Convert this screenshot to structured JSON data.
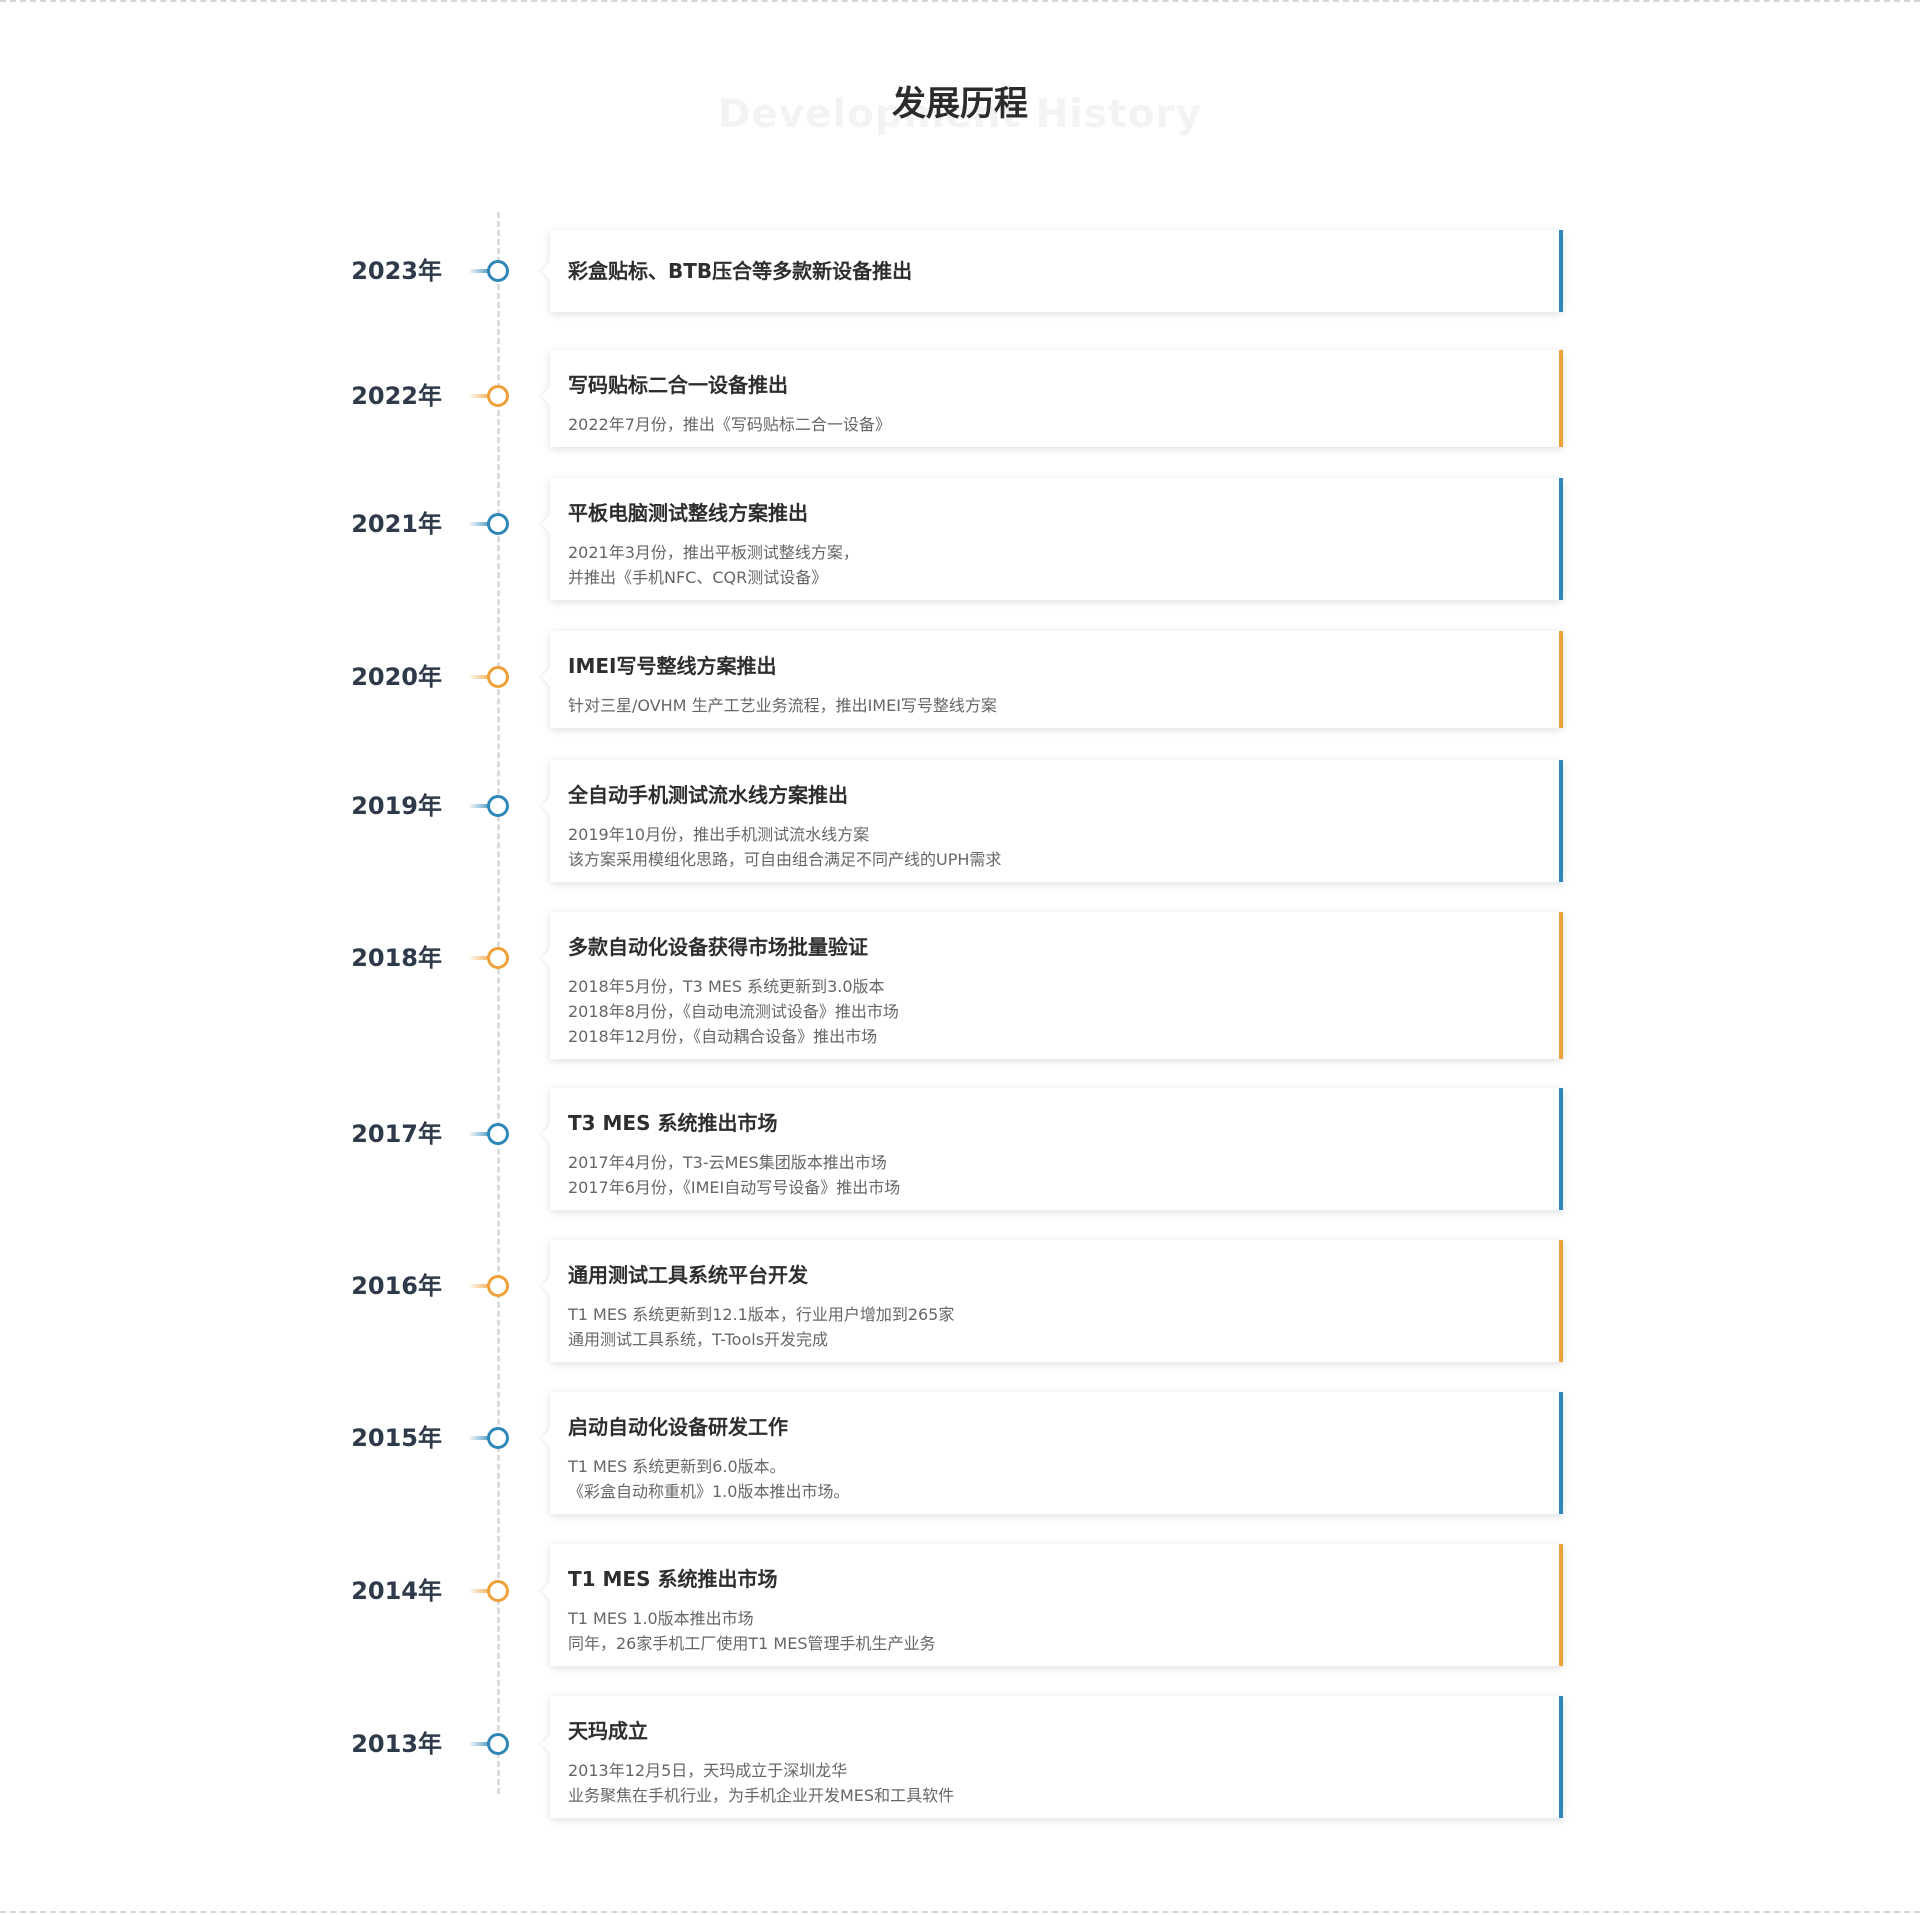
{
  "heading": {
    "title": "发展历程",
    "subtitle": "Development History"
  },
  "colors": {
    "blue": "#2f86b8",
    "orange": "#eea03a"
  },
  "timeline": [
    {
      "year": "2023年",
      "color": "blue",
      "title": "彩盒贴标、BTB压合等多款新设备推出",
      "lines": []
    },
    {
      "year": "2022年",
      "color": "orange",
      "title": "写码贴标二合一设备推出",
      "lines": [
        "2022年7月份，推出《写码贴标二合一设备》"
      ]
    },
    {
      "year": "2021年",
      "color": "blue",
      "title": "平板电脑测试整线方案推出",
      "lines": [
        "2021年3月份，推出平板测试整线方案，",
        "并推出《手机NFC、CQR测试设备》"
      ]
    },
    {
      "year": "2020年",
      "color": "orange",
      "title": "IMEI写号整线方案推出",
      "lines": [
        "针对三星/OVHM 生产工艺业务流程，推出IMEI写号整线方案"
      ]
    },
    {
      "year": "2019年",
      "color": "blue",
      "title": "全自动手机测试流水线方案推出",
      "lines": [
        "2019年10月份，推出手机测试流水线方案",
        "该方案采用模组化思路，可自由组合满足不同产线的UPH需求"
      ]
    },
    {
      "year": "2018年",
      "color": "orange",
      "title": "多款自动化设备获得市场批量验证",
      "lines": [
        "2018年5月份，T3 MES 系统更新到3.0版本",
        "2018年8月份，《自动电流测试设备》推出市场",
        "2018年12月份，《自动耦合设备》推出市场"
      ]
    },
    {
      "year": "2017年",
      "color": "blue",
      "title": "T3 MES 系统推出市场",
      "lines": [
        "2017年4月份，T3-云MES集团版本推出市场",
        "2017年6月份，《IMEI自动写号设备》推出市场"
      ]
    },
    {
      "year": "2016年",
      "color": "orange",
      "title": "通用测试工具系统平台开发",
      "lines": [
        "T1 MES 系统更新到12.1版本，行业用户增加到265家",
        "通用测试工具系统，T-Tools开发完成"
      ]
    },
    {
      "year": "2015年",
      "color": "blue",
      "title": "启动自动化设备研发工作",
      "lines": [
        "T1 MES 系统更新到6.0版本。",
        "《彩盒自动称重机》1.0版本推出市场。"
      ]
    },
    {
      "year": "2014年",
      "color": "orange",
      "title": "T1 MES 系统推出市场",
      "lines": [
        "T1 MES 1.0版本推出市场",
        "同年，26家手机工厂使用T1 MES管理手机生产业务"
      ]
    },
    {
      "year": "2013年",
      "color": "blue",
      "title": "天玛成立",
      "lines": [
        "2013年12月5日，天玛成立于深圳龙华",
        "业务聚焦在手机行业，为手机企业开发MES和工具软件"
      ]
    }
  ]
}
